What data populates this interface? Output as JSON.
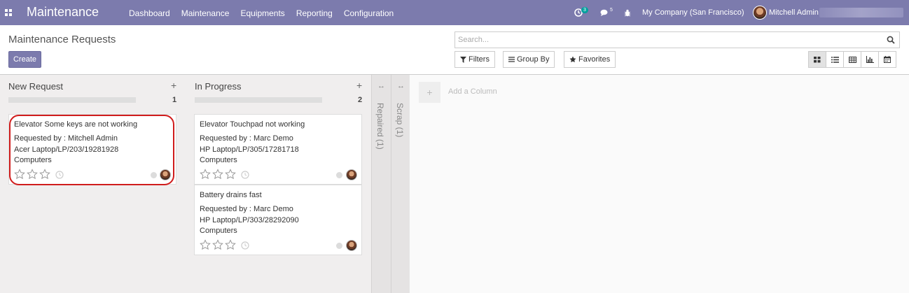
{
  "navbar": {
    "app_name": "Maintenance",
    "menu": [
      "Dashboard",
      "Maintenance",
      "Equipments",
      "Reporting",
      "Configuration"
    ],
    "activity_count": "3",
    "message_count": "5",
    "company": "My Company (San Francisco)",
    "user": "Mitchell Admin"
  },
  "control": {
    "title": "Maintenance Requests",
    "create_label": "Create",
    "search_placeholder": "Search...",
    "filters_label": "Filters",
    "groupby_label": "Group By",
    "favorites_label": "Favorites"
  },
  "columns": [
    {
      "title": "New Request",
      "count": "1",
      "cards": [
        {
          "title": "Elevator Some keys are not working",
          "requested_by": "Requested by : Mitchell Admin",
          "equipment": "Acer Laptop/LP/203/19281928",
          "category": "Computers",
          "priority_stars": 0
        }
      ]
    },
    {
      "title": "In Progress",
      "count": "2",
      "cards": [
        {
          "title": "Elevator Touchpad not working",
          "requested_by": "Requested by : Marc Demo",
          "equipment": "HP Laptop/LP/305/17281718",
          "category": "Computers",
          "priority_stars": 0
        },
        {
          "title": "Battery drains fast",
          "requested_by": "Requested by : Marc Demo",
          "equipment": "HP Laptop/LP/303/28292090",
          "category": "Computers",
          "priority_stars": 0
        }
      ]
    }
  ],
  "folded_columns": [
    "Repaired (1)",
    "Scrap (1)"
  ],
  "add_column_label": "Add a Column",
  "colors": {
    "brand": "#7c7bad",
    "badge": "#00a09d",
    "highlight": "#d01c1c"
  }
}
